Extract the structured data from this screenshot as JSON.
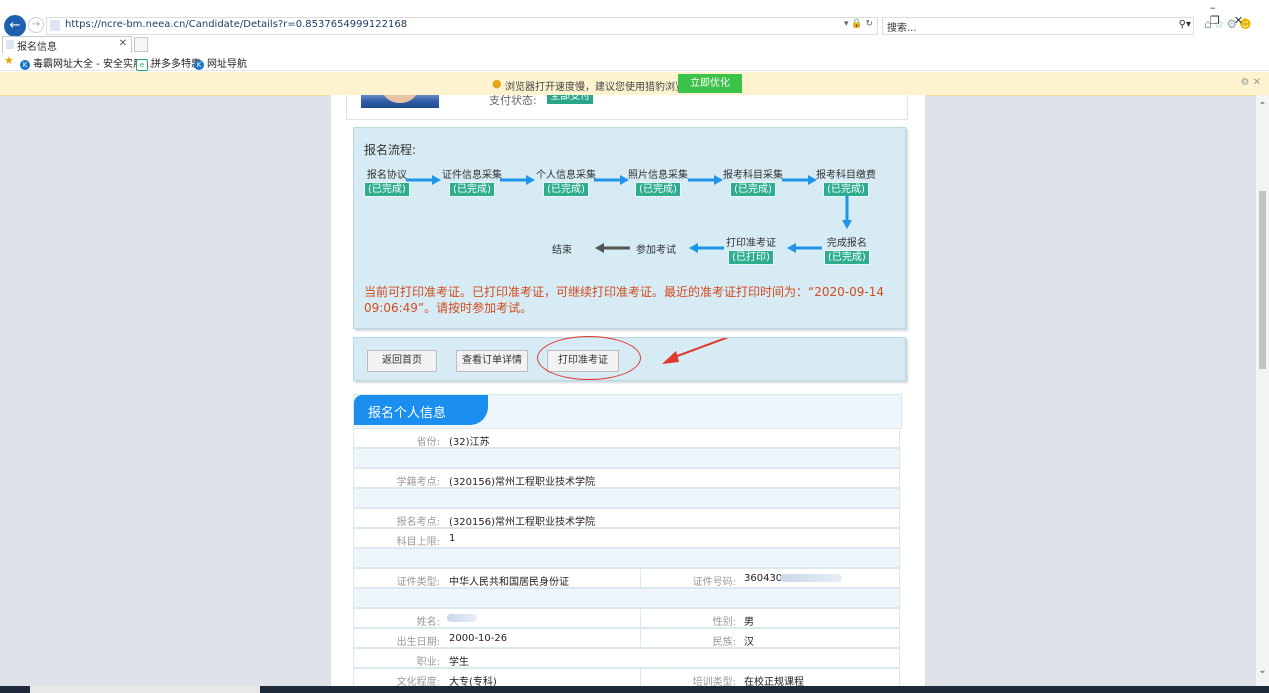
{
  "browser": {
    "url": "https://ncre-bm.neea.cn/Candidate/Details?r=0.8537654999122168",
    "search_placeholder": "搜索...",
    "tab_title": "报名信息",
    "favorites": [
      "毒霸网址大全 - 安全实用...",
      "拼多多特惠",
      "网址导航"
    ]
  },
  "notice": {
    "text": "浏览器打开速度慢，建议您使用猎豹浏览器优化",
    "button": "立即优化"
  },
  "payment": {
    "label": "支付状态:",
    "status": "全部支付"
  },
  "flow": {
    "title": "报名流程:",
    "steps": [
      {
        "label": "报名协议",
        "status": "(已完成)"
      },
      {
        "label": "证件信息采集",
        "status": "(已完成)"
      },
      {
        "label": "个人信息采集",
        "status": "(已完成)"
      },
      {
        "label": "照片信息采集",
        "status": "(已完成)"
      },
      {
        "label": "报考科目采集",
        "status": "(已完成)"
      },
      {
        "label": "报考科目缴费",
        "status": "(已完成)"
      },
      {
        "label": "完成报名",
        "status": "(已完成)"
      },
      {
        "label": "打印准考证",
        "status": "(已打印)"
      },
      {
        "label": "参加考试",
        "status": ""
      },
      {
        "label": "结束",
        "status": ""
      }
    ],
    "message": "当前可打印准考证。已打印准考证，可继续打印准考证。最近的准考证打印时间为：“2020-09-14 09:06:49”。请按时参加考试。"
  },
  "actions": {
    "home": "返回首页",
    "order": "查看订单详情",
    "print": "打印准考证"
  },
  "info": {
    "title": "报名个人信息",
    "province": {
      "label": "省份:",
      "value": "(32)江苏"
    },
    "school_site": {
      "label": "学籍考点:",
      "value": "(320156)常州工程职业技术学院"
    },
    "exam_site": {
      "label": "报名考点:",
      "value": "(320156)常州工程职业技术学院"
    },
    "subject_limit": {
      "label": "科目上限:",
      "value": "1"
    },
    "id_type": {
      "label": "证件类型:",
      "value": "中华人民共和国居民身份证"
    },
    "id_no": {
      "label": "证件号码:",
      "value": "360430"
    },
    "name": {
      "label": "姓名:",
      "value": ""
    },
    "gender": {
      "label": "性别:",
      "value": "男"
    },
    "birth": {
      "label": "出生日期:",
      "value": "2000-10-26"
    },
    "nation": {
      "label": "民族:",
      "value": "汉"
    },
    "job": {
      "label": "职业:",
      "value": "学生"
    },
    "education": {
      "label": "文化程度:",
      "value": "大专(专科)"
    },
    "training": {
      "label": "培训类型:",
      "value": "在校正规课程"
    }
  }
}
